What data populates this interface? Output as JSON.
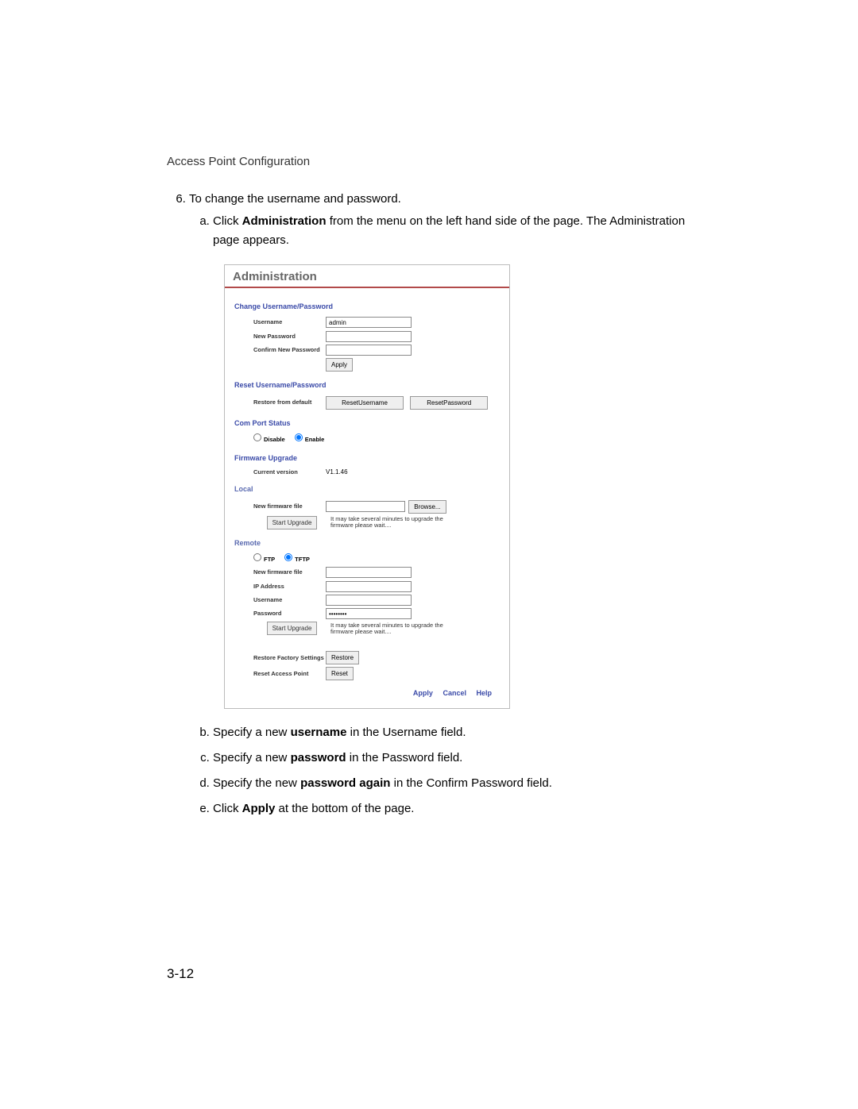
{
  "page": {
    "section": "Access Point Configuration",
    "number": "3-12"
  },
  "steps": [
    {
      "text": "To change the username and password.",
      "sub": [
        {
          "pre": "Click ",
          "bold": "Administration",
          "post": " from the menu on the left hand side of the page. ",
          "line2": "The Administration page appears."
        },
        {
          "pre": "Specify a new ",
          "bold": "username",
          "post": " in the Username field."
        },
        {
          "pre": "Specify a new ",
          "bold": "password",
          "post": " in the Password field."
        },
        {
          "pre": "Specify the new ",
          "bold": "password again",
          "post": " in the Confirm Password field."
        },
        {
          "pre": "Click ",
          "bold": "Apply",
          "post": " at the bottom of the page."
        }
      ]
    }
  ],
  "panel": {
    "title": "Administration",
    "sections": {
      "change": "Change Username/Password",
      "reset": "Reset Username/Password",
      "comPort": "Com Port Status",
      "firmware": "Firmware Upgrade",
      "local": "Local",
      "remote": "Remote"
    },
    "labels": {
      "username": "Username",
      "newPassword": "New Password",
      "confirmNew": "Confirm New Password",
      "restoreDefault": "Restore from default",
      "disable": "Disable",
      "enable": "Enable",
      "currentVersion": "Current version",
      "newFirmware": "New firmware file",
      "ftp": "FTP",
      "tftp": "TFTP",
      "ipAddress": "IP Address",
      "password": "Password",
      "restoreFactory": "Restore Factory Settings",
      "resetAP": "Reset Access Point"
    },
    "values": {
      "username": "admin",
      "version": "V1.1.46",
      "remotePassword": "********"
    },
    "buttons": {
      "apply": "Apply",
      "resetUsername": "ResetUsername",
      "resetPassword": "ResetPassword",
      "browse": "Browse...",
      "startUpgrade": "Start Upgrade",
      "restore": "Restore",
      "reset": "Reset"
    },
    "notes": {
      "upgrade": "It may take several minutes to upgrade the firmware please wait...."
    },
    "footer": {
      "apply": "Apply",
      "cancel": "Cancel",
      "help": "Help"
    }
  }
}
